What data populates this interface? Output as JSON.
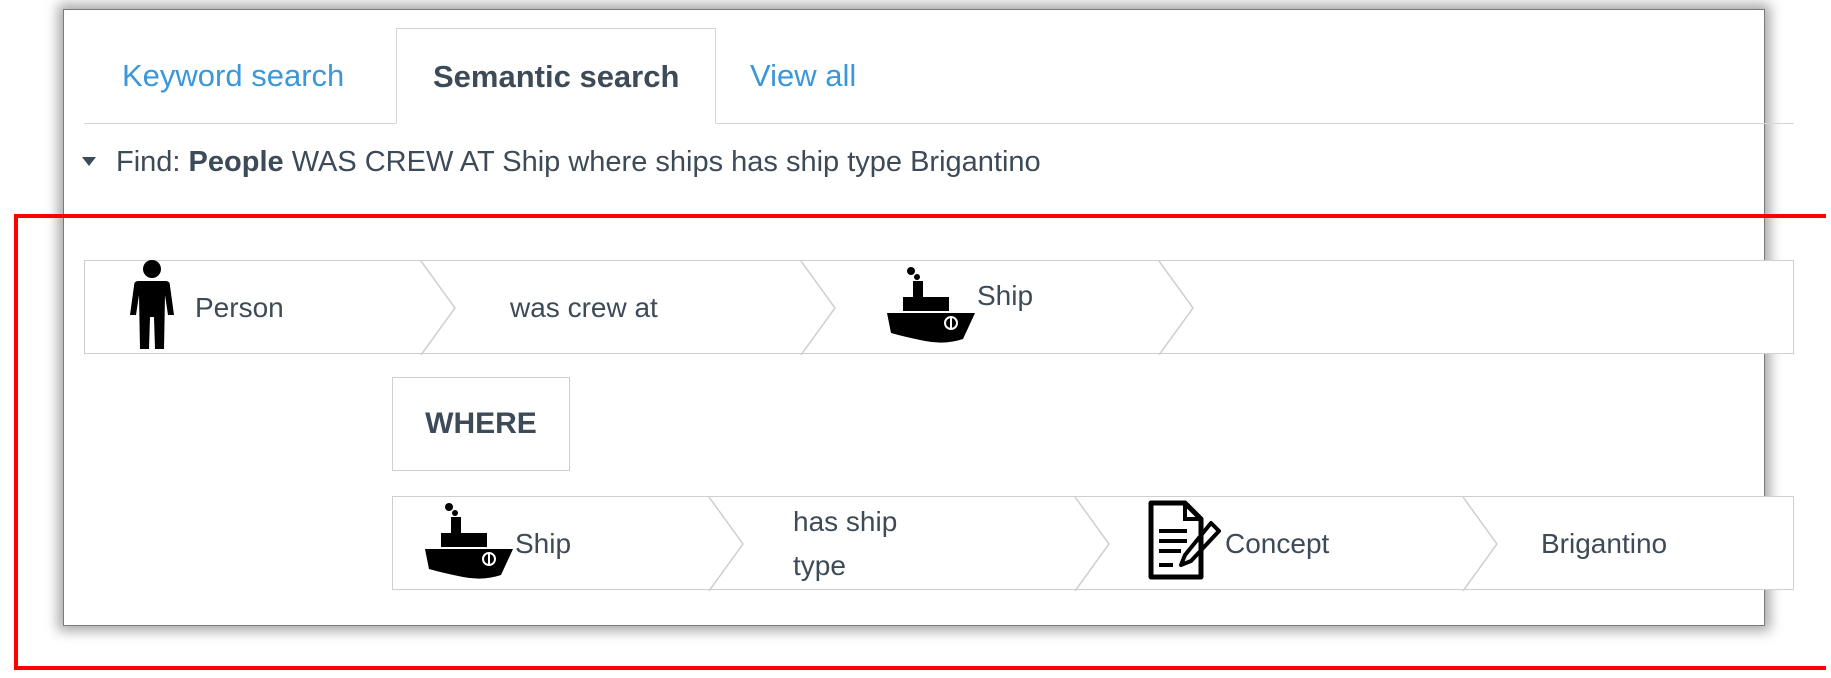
{
  "tabs": [
    {
      "label": "Keyword search",
      "active": false
    },
    {
      "label": "Semantic search",
      "active": true
    },
    {
      "label": "View all",
      "active": false
    }
  ],
  "summary": {
    "prefix": "Find:",
    "entity": "People",
    "rest": "WAS CREW AT Ship where ships has ship type Brigantino"
  },
  "query": {
    "row1": [
      {
        "label": "Person",
        "icon": "person-icon"
      },
      {
        "label": "was crew at"
      },
      {
        "label": "Ship",
        "icon": "ship-icon"
      }
    ],
    "where_label": "WHERE",
    "row2": [
      {
        "label": "Ship",
        "icon": "ship-icon"
      },
      {
        "label": "has ship type"
      },
      {
        "label": "Concept",
        "icon": "document-icon"
      },
      {
        "label": "Brigantino"
      }
    ]
  },
  "colors": {
    "tab_link": "#3a98d8",
    "text": "#3d4a57",
    "highlight": "#ff0000"
  }
}
